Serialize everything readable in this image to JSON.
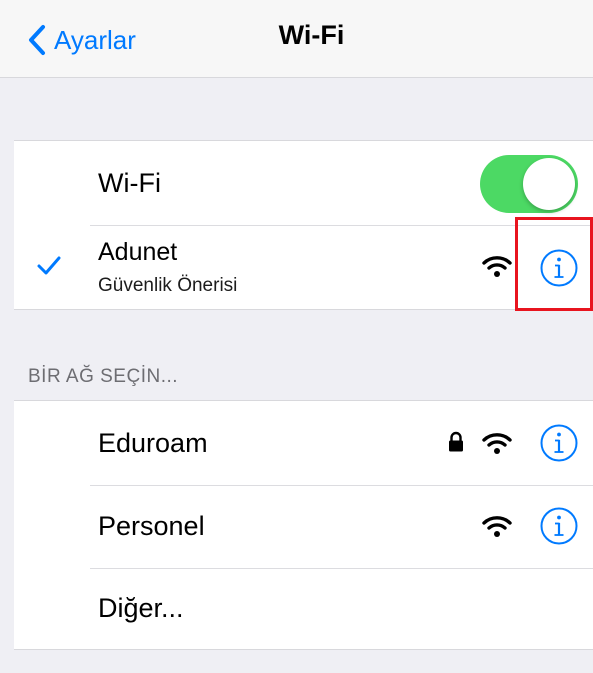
{
  "navbar": {
    "back_label": "Ayarlar",
    "title": "Wi-Fi"
  },
  "wifi_toggle": {
    "label": "Wi-Fi",
    "state": "on",
    "on_color": "#4cd964"
  },
  "connected_network": {
    "name": "Adunet",
    "subtitle": "Güvenlik Önerisi",
    "selected": true,
    "locked": false
  },
  "section_header": "BİR AĞ SEÇİN...",
  "networks": [
    {
      "name": "Eduroam",
      "locked": true
    },
    {
      "name": "Personel",
      "locked": false
    }
  ],
  "other_label": "Diğer...",
  "colors": {
    "accent": "#007aff",
    "highlight": "#e8141f",
    "background": "#efeff4"
  }
}
